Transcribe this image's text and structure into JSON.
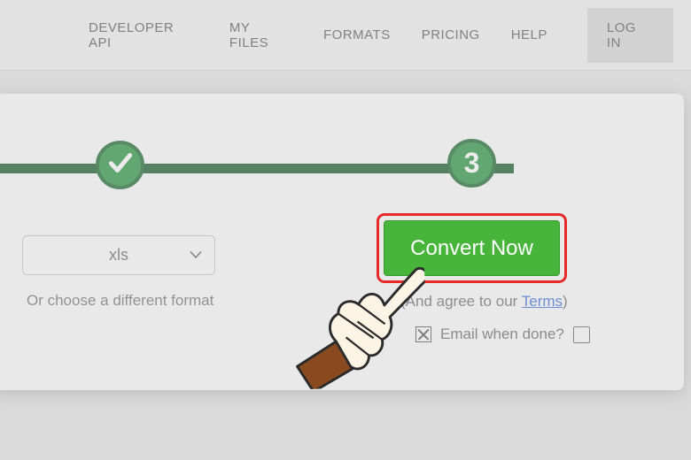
{
  "nav": {
    "items": [
      "DEVELOPER API",
      "MY FILES",
      "FORMATS",
      "PRICING",
      "HELP"
    ],
    "login": "LOG IN"
  },
  "stepper": {
    "current_step": "3"
  },
  "format": {
    "selected": "xls",
    "alt_text": "Or choose a different format"
  },
  "convert": {
    "button_label": "Convert Now",
    "agree_prefix": "(And agree to our ",
    "terms_label": "Terms",
    "agree_suffix": ")"
  },
  "email_done": {
    "label": "Email when done?"
  }
}
